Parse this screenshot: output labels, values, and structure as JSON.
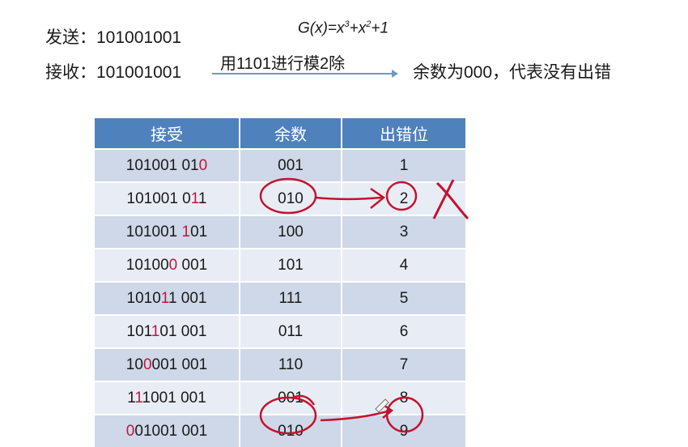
{
  "header": {
    "send_label": "发送：",
    "send_value": "101001001",
    "recv_label": "接收：",
    "recv_value": "101001001",
    "poly_prefix": "G(x)=x",
    "poly_exp1": "3",
    "poly_mid": "+x",
    "poly_exp2": "2",
    "poly_suffix": "+1",
    "arrow_label": "用1101进行模2除",
    "result": "余数为000，代表没有出错"
  },
  "table": {
    "headers": [
      "接受",
      "余数",
      "出错位"
    ],
    "rows": [
      {
        "pre": "101001 01",
        "err": "0",
        "post": "",
        "rem": "001",
        "pos": "1"
      },
      {
        "pre": "101001 0",
        "err": "1",
        "post": "1",
        "rem": "010",
        "pos": "2"
      },
      {
        "pre": "101001 ",
        "err": "1",
        "post": "01",
        "rem": "100",
        "pos": "3"
      },
      {
        "pre": "10100",
        "err": "0",
        "post": " 001",
        "rem": "101",
        "pos": "4"
      },
      {
        "pre": "1010",
        "err": "1",
        "post": "1 001",
        "rem": "111",
        "pos": "5"
      },
      {
        "pre": "101",
        "err": "1",
        "post": "01 001",
        "rem": "011",
        "pos": "6"
      },
      {
        "pre": "10",
        "err": "0",
        "post": "001 001",
        "rem": "110",
        "pos": "7"
      },
      {
        "pre": "1",
        "err": "1",
        "post": "1001 001",
        "rem": "001",
        "pos": "8"
      },
      {
        "pre": "",
        "err": "0",
        "post": "01001 001",
        "rem": "010",
        "pos": "9"
      }
    ]
  },
  "colors": {
    "header_bg": "#4f81bd",
    "row_dark": "#cfd8e8",
    "row_light": "#e8edf5",
    "error_bit": "#c0163f",
    "annotation": "#c4122f"
  }
}
